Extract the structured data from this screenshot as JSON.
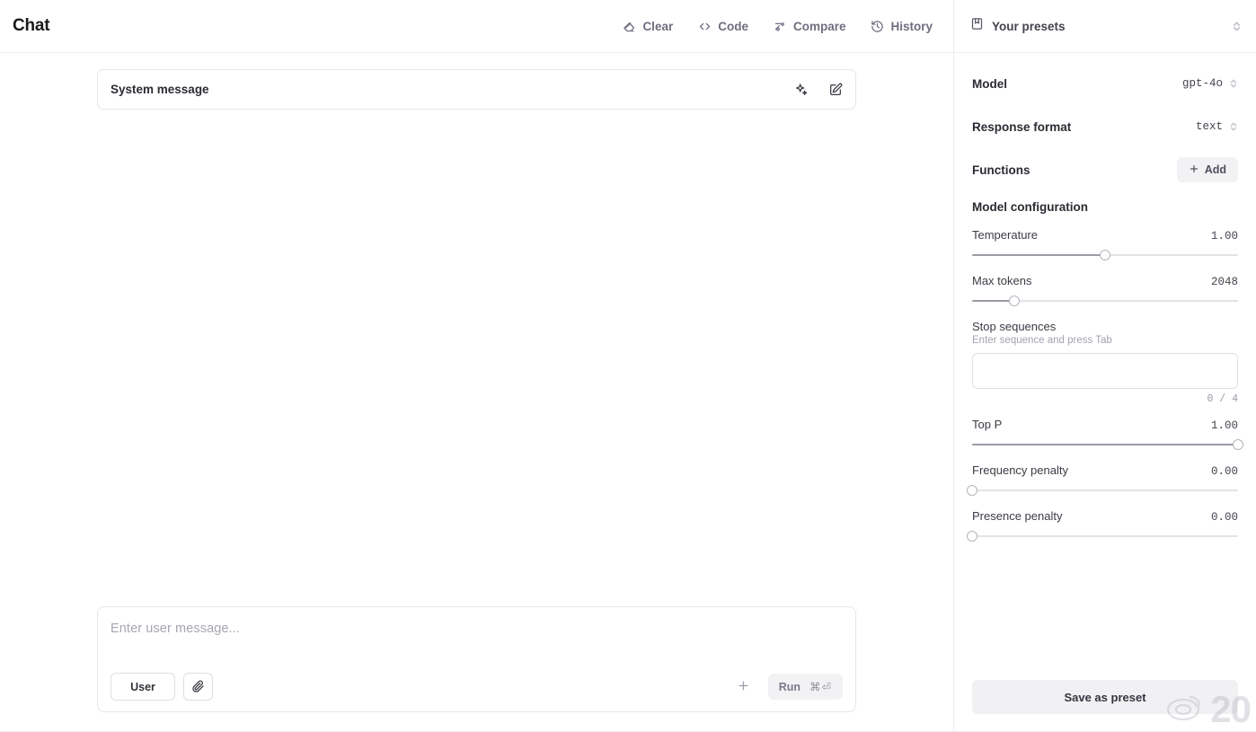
{
  "header": {
    "title": "Chat",
    "actions": [
      {
        "label": "Clear",
        "icon": "eraser-icon"
      },
      {
        "label": "Code",
        "icon": "code-icon"
      },
      {
        "label": "Compare",
        "icon": "compare-icon"
      },
      {
        "label": "History",
        "icon": "history-icon"
      }
    ],
    "presets": {
      "label": "Your presets",
      "icon": "bookmark-icon",
      "selector_icon": "chevron-up-down-icon"
    }
  },
  "chat": {
    "system": {
      "label": "System message",
      "magic_icon": "sparkle-icon",
      "edit_icon": "edit-square-icon"
    },
    "composer": {
      "placeholder": "Enter user message...",
      "role_label": "User",
      "attach_icon": "paperclip-icon",
      "add_icon": "plus-icon",
      "run_label": "Run",
      "run_shortcut": "⌘⏎"
    }
  },
  "panel": {
    "model": {
      "label": "Model",
      "value": "gpt-4o"
    },
    "response_format": {
      "label": "Response format",
      "value": "text"
    },
    "functions": {
      "label": "Functions",
      "add_label": "Add",
      "add_icon": "plus-icon"
    },
    "config_title": "Model configuration",
    "params": [
      {
        "label": "Temperature",
        "value": "1.00",
        "percent": 50
      },
      {
        "label": "Max tokens",
        "value": "2048",
        "percent": 16
      }
    ],
    "stop_sequences": {
      "label": "Stop sequences",
      "help": "Enter sequence and press Tab",
      "value": "",
      "placeholder": "",
      "count": "0 / 4"
    },
    "params2": [
      {
        "label": "Top P",
        "value": "1.00",
        "percent": 100
      },
      {
        "label": "Frequency penalty",
        "value": "0.00",
        "percent": 0
      },
      {
        "label": "Presence penalty",
        "value": "0.00",
        "percent": 0
      }
    ],
    "save_preset_label": "Save as preset"
  },
  "watermark": {
    "text": "20",
    "logo": "weibo-eye-icon"
  }
}
